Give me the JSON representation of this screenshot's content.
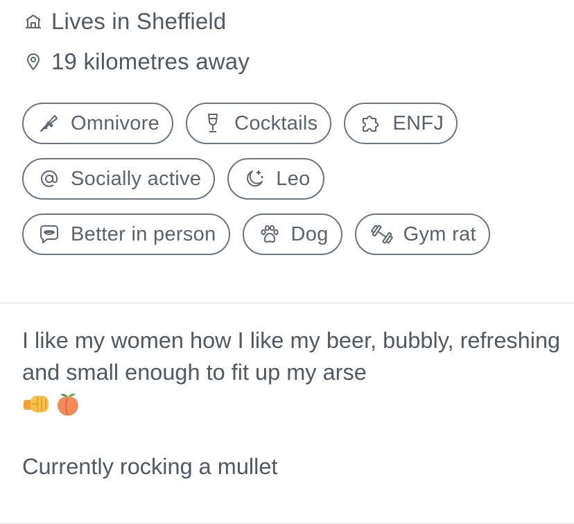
{
  "info": {
    "location": "Lives in Sheffield",
    "distance": "19 kilometres away",
    "location_icon": "home-icon",
    "distance_icon": "map-pin-icon"
  },
  "chips": [
    [
      {
        "label": "Omnivore",
        "icon": "pizza-icon"
      },
      {
        "label": "Cocktails",
        "icon": "wine-glass-icon"
      },
      {
        "label": "ENFJ",
        "icon": "puzzle-icon"
      }
    ],
    [
      {
        "label": "Socially active",
        "icon": "at-sign-icon"
      },
      {
        "label": "Leo",
        "icon": "moon-stars-icon"
      }
    ],
    [
      {
        "label": "Better in person",
        "icon": "speech-lips-icon"
      },
      {
        "label": "Dog",
        "icon": "paw-icon"
      },
      {
        "label": "Gym rat",
        "icon": "dumbbell-icon"
      }
    ]
  ],
  "bio": {
    "paragraph1": "I like my women how I like my beer, bubbly, refreshing and small enough to fit up my arse",
    "emojis": [
      "🤜",
      "🍑"
    ],
    "paragraph2": "Currently rocking a mullet"
  },
  "colors": {
    "text": "#4f5864",
    "chip_border": "#6b7480",
    "divider": "#ececee"
  }
}
